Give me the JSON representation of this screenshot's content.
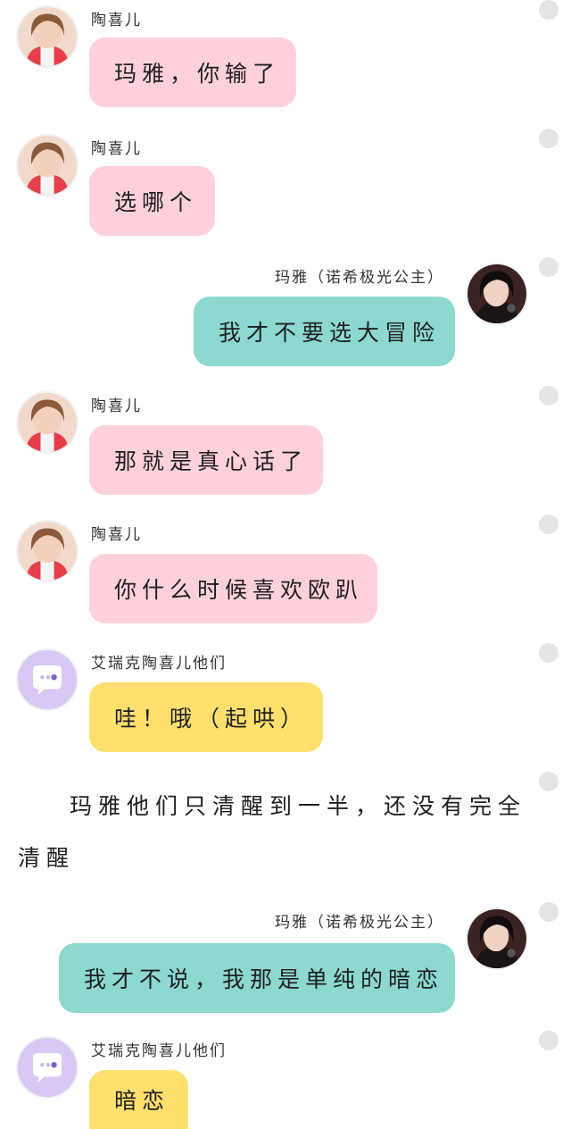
{
  "colors": {
    "pink_bubble": "#ffd1dc",
    "teal_bubble": "#8dd9d0",
    "yellow_bubble": "#ffe06f",
    "bot_avatar_bg": "#d8c8f5",
    "dot": "#e4e4e4"
  },
  "messages": [
    {
      "sender": "陶喜儿",
      "text": "玛雅，你输了",
      "side": "left",
      "bubble_color": "pink"
    },
    {
      "sender": "陶喜儿",
      "text": "选哪个",
      "side": "left",
      "bubble_color": "pink"
    },
    {
      "sender": "玛雅（诺希极光公主）",
      "text": "我才不要选大冒险",
      "side": "right",
      "bubble_color": "teal"
    },
    {
      "sender": "陶喜儿",
      "text": "那就是真心话了",
      "side": "left",
      "bubble_color": "pink"
    },
    {
      "sender": "陶喜儿",
      "text": "你什么时候喜欢欧趴",
      "side": "left",
      "bubble_color": "pink"
    },
    {
      "sender": "艾瑞克陶喜儿他们",
      "text": "哇！哦（起哄）",
      "side": "left",
      "bubble_color": "yellow"
    },
    {
      "sender": "玛雅（诺希极光公主）",
      "text": "我才不说，我那是单纯的暗恋",
      "side": "right",
      "bubble_color": "teal"
    },
    {
      "sender": "艾瑞克陶喜儿他们",
      "text": "暗恋",
      "side": "left",
      "bubble_color": "yellow"
    }
  ],
  "narration": "玛雅他们只清醒到一半，还没有完全清醒"
}
